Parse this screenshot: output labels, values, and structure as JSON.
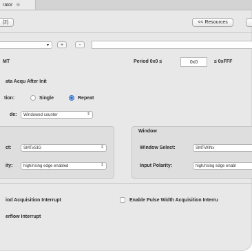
{
  "tab": {
    "title": "rator",
    "close_icon": "close-icon"
  },
  "toolbar": {
    "left_button": "(2)",
    "resources_button": "<< Resources"
  },
  "top_row": {
    "select_arrow": "▾",
    "plus": "+",
    "minus": "-"
  },
  "header": {
    "left_label": "MT",
    "period_label": "Period 0x0 ≤",
    "period_value": "0x0",
    "period_max": "≤ 0xFFF"
  },
  "acquisition": {
    "after_init_label": "ata Acqu After Init",
    "mode_prefix": "tion:",
    "single_label": "Single",
    "repeat_label": "Repeat",
    "selected": "Repeat",
    "counter_prefix": "de:",
    "counter_value": "Windowed counter",
    "counter_arrow": "⇕"
  },
  "left_group": {
    "select_label": "ct:",
    "select_value": "SMTxSIG",
    "polarity_label": "ity:",
    "polarity_value": "high/rising edge enabled",
    "arrow": "⇕"
  },
  "window_group": {
    "title": "Window",
    "select_label": "Window Select:",
    "select_value": "SMTWINx",
    "polarity_label": "Input Polarity:",
    "polarity_value": "high/rising edge enabl"
  },
  "interrupts": {
    "period_acq": "iod Acquisition Interrupt",
    "pulse_width": "Enable Pulse Width Acquisition Interru",
    "overflow": "erflow Interrupt"
  }
}
